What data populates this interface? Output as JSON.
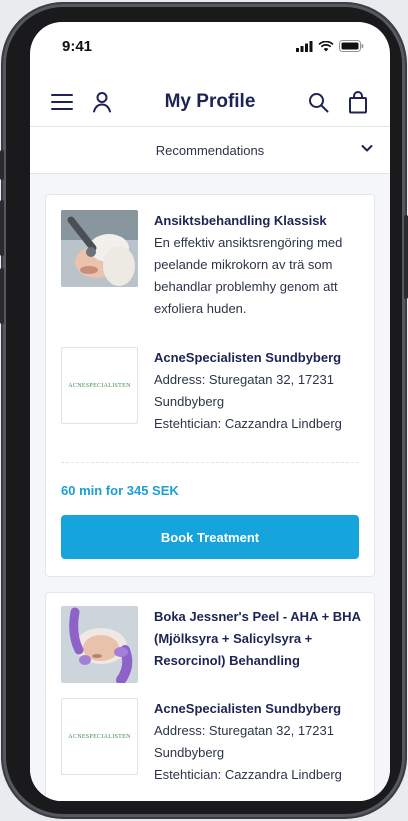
{
  "status_bar": {
    "time": "9:41"
  },
  "header": {
    "title": "My Profile"
  },
  "dropdown": {
    "label": "Recommendations"
  },
  "cards": [
    {
      "treatment_name": "Ansiktsbehandling Klassisk",
      "description": [
        "En effektiv ansiktsrengöring med",
        "peelande mikrokorn av trä som",
        "behandlar problemhy genom att",
        "exfoliera huden."
      ],
      "clinic_name": "AcneSpecialisten Sundbyberg",
      "address": [
        "Address: Sturegatan 32, 17231",
        "Sundbyberg"
      ],
      "esthetician": "Estehtician: Cazzandra Lindberg",
      "logo_text": "ACNESPECIALISTEN",
      "price": "60 min for 345 SEK",
      "book_label": "Book Treatment"
    },
    {
      "treatment_name": [
        "Boka Jessner's Peel - AHA + BHA",
        "(Mjölksyra + Salicylsyra +",
        "Resorcinol) Behandling"
      ],
      "clinic_name": "AcneSpecialisten Sundbyberg",
      "address": [
        "Address: Sturegatan 32, 17231",
        "Sundbyberg"
      ],
      "esthetician": "Estehtician: Cazzandra Lindberg",
      "logo_text": "ACNESPECIALISTEN"
    }
  ],
  "colors": {
    "accent": "#16a4dd",
    "title": "#1d2454",
    "background": "#f4f6f8"
  }
}
